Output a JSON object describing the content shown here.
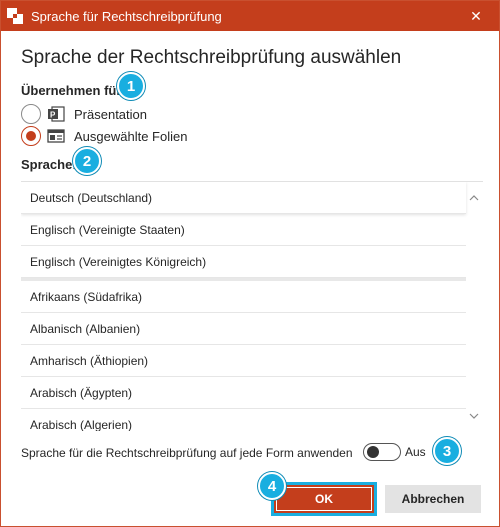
{
  "window": {
    "title": "Sprache für Rechtschreibprüfung",
    "close_glyph": "✕"
  },
  "heading": "Sprache der Rechtschreibprüfung auswählen",
  "apply_for": {
    "label": "Übernehmen für:",
    "badge": "1",
    "options": [
      {
        "label": "Präsentation",
        "checked": false,
        "icon": "powerpoint-icon"
      },
      {
        "label": "Ausgewählte Folien",
        "checked": true,
        "icon": "slides-icon"
      }
    ]
  },
  "language": {
    "label": "Sprache:",
    "badge": "2",
    "selected": "Deutsch (Deutschland)",
    "recent": [
      "Deutsch (Deutschland)",
      "Englisch (Vereinigte Staaten)",
      "Englisch (Vereinigtes Königreich)"
    ],
    "all": [
      "Afrikaans (Südafrika)",
      "Albanisch (Albanien)",
      "Amharisch (Äthiopien)",
      "Arabisch (Ägypten)",
      "Arabisch (Algerien)"
    ]
  },
  "apply_all_shapes": {
    "text": "Sprache für die Rechtschreibprüfung auf jede Form anwenden",
    "toggle_state": "Aus",
    "badge": "3"
  },
  "buttons": {
    "ok": "OK",
    "ok_badge": "4",
    "cancel": "Abbrechen"
  },
  "colors": {
    "accent": "#c43e1c",
    "callout": "#19aee0"
  }
}
